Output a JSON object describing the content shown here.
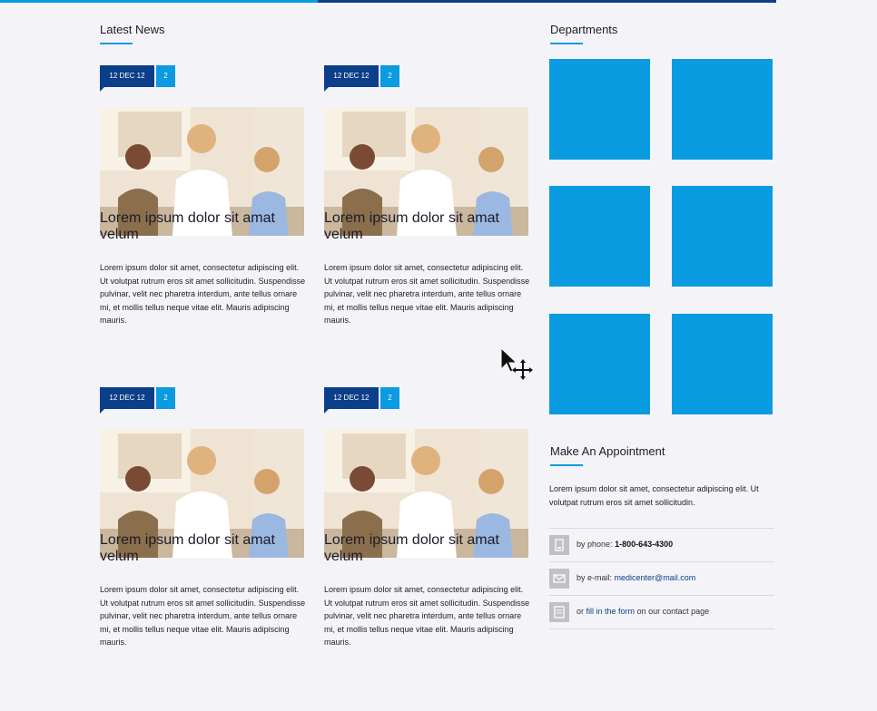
{
  "colors": {
    "accent": "#0a9be0",
    "brand_dark": "#0b3f8a",
    "background": "#f4f4f8"
  },
  "latest_news": {
    "title": "Latest News",
    "posts": [
      {
        "date": "12 DEC 12",
        "comments": "2",
        "title": "Lorem ipsum dolor sit amat velum",
        "excerpt": "Lorem ipsum dolor sit amet, consectetur adipiscing elit. Ut volutpat rutrum eros sit amet sollicitudin. Suspendisse pulvinar, velit nec pharetra interdum, ante tellus ornare mi, et mollis tellus neque vitae elit. Mauris adipiscing mauris."
      },
      {
        "date": "12 DEC 12",
        "comments": "2",
        "title": "Lorem ipsum dolor sit amat velum",
        "excerpt": "Lorem ipsum dolor sit amet, consectetur adipiscing elit. Ut volutpat rutrum eros sit amet sollicitudin. Suspendisse pulvinar, velit nec pharetra interdum, ante tellus ornare mi, et mollis tellus neque vitae elit. Mauris adipiscing mauris."
      },
      {
        "date": "12 DEC 12",
        "comments": "2",
        "title": "Lorem ipsum dolor sit amat velum",
        "excerpt": "Lorem ipsum dolor sit amet, consectetur adipiscing elit. Ut volutpat rutrum eros sit amet sollicitudin. Suspendisse pulvinar, velit nec pharetra interdum, ante tellus ornare mi, et mollis tellus neque vitae elit. Mauris adipiscing mauris."
      },
      {
        "date": "12 DEC 12",
        "comments": "2",
        "title": "Lorem ipsum dolor sit amat velum",
        "excerpt": "Lorem ipsum dolor sit amet, consectetur adipiscing elit. Ut volutpat rutrum eros sit amet sollicitudin. Suspendisse pulvinar, velit nec pharetra interdum, ante tellus ornare mi, et mollis tellus neque vitae elit. Mauris adipiscing mauris."
      }
    ]
  },
  "departments": {
    "title": "Departments"
  },
  "appointment": {
    "title": "Make An Appointment",
    "text": "Lorem ipsum dolor sit amet, consectetur adipiscing elit. Ut volutpat rutrum eros sit amet sollicitudin.",
    "phone": {
      "prefix": "by phone:",
      "value": "1-800-643-4300"
    },
    "email": {
      "prefix": "by e-mail:",
      "value": "medicenter@mail.com"
    },
    "form": {
      "prefix": "or",
      "link": "fill in the form",
      "suffix": "on our contact page"
    }
  }
}
